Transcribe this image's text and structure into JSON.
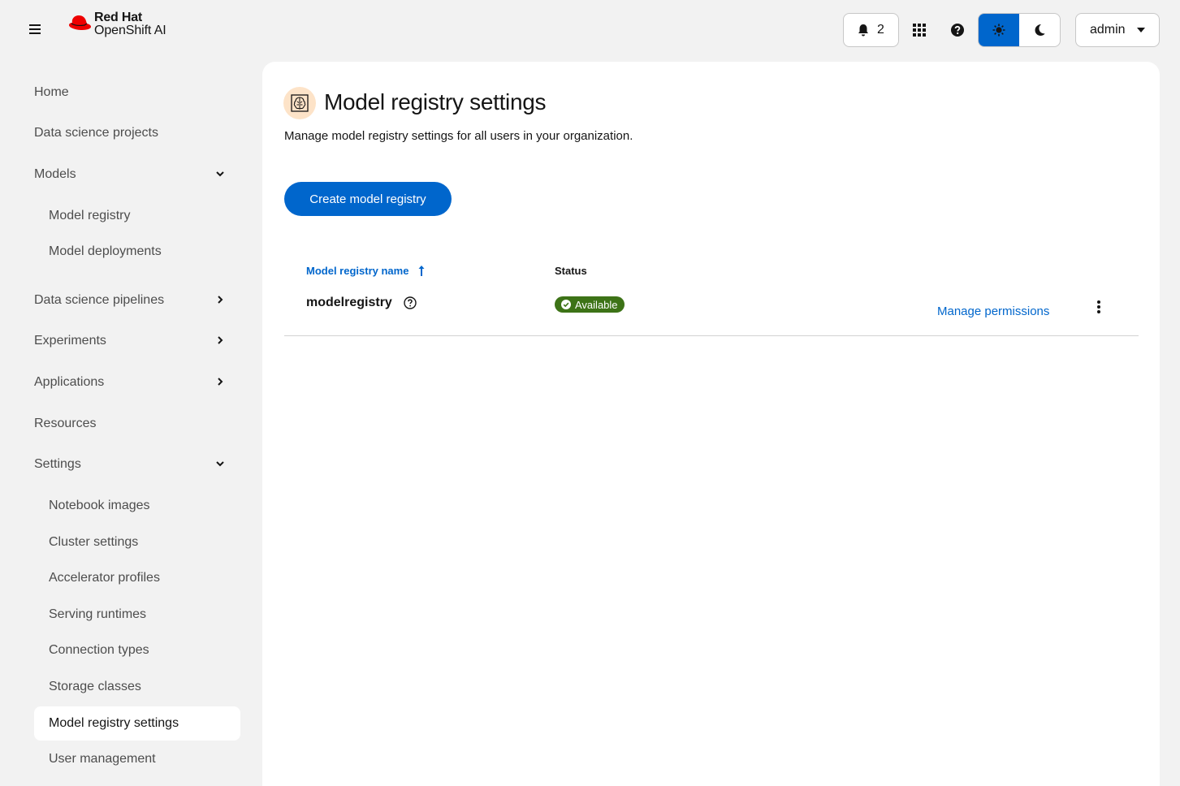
{
  "masthead": {
    "brand": "Red Hat",
    "product": "OpenShift AI",
    "notifications_count": "2",
    "user": "admin"
  },
  "sidebar": {
    "items": [
      {
        "label": "Home"
      },
      {
        "label": "Data science projects"
      },
      {
        "label": "Models"
      },
      {
        "label": "Model registry"
      },
      {
        "label": "Model deployments"
      },
      {
        "label": "Data science pipelines"
      },
      {
        "label": "Experiments"
      },
      {
        "label": "Applications"
      },
      {
        "label": "Resources"
      },
      {
        "label": "Settings"
      },
      {
        "label": "Notebook images"
      },
      {
        "label": "Cluster settings"
      },
      {
        "label": "Accelerator profiles"
      },
      {
        "label": "Serving runtimes"
      },
      {
        "label": "Connection types"
      },
      {
        "label": "Storage classes"
      },
      {
        "label": "Model registry settings"
      },
      {
        "label": "User management"
      }
    ]
  },
  "main": {
    "title": "Model registry settings",
    "description": "Manage model registry settings for all users in your organization.",
    "create_button": "Create model registry",
    "table": {
      "columns": [
        "Model registry name",
        "Status"
      ],
      "rows": [
        {
          "name": "modelregistry",
          "status": "Available",
          "action": "Manage permissions"
        }
      ]
    }
  },
  "colors": {
    "accent": "#0066cc",
    "status_available": "#3d7317",
    "brand_red": "#ee0000"
  }
}
